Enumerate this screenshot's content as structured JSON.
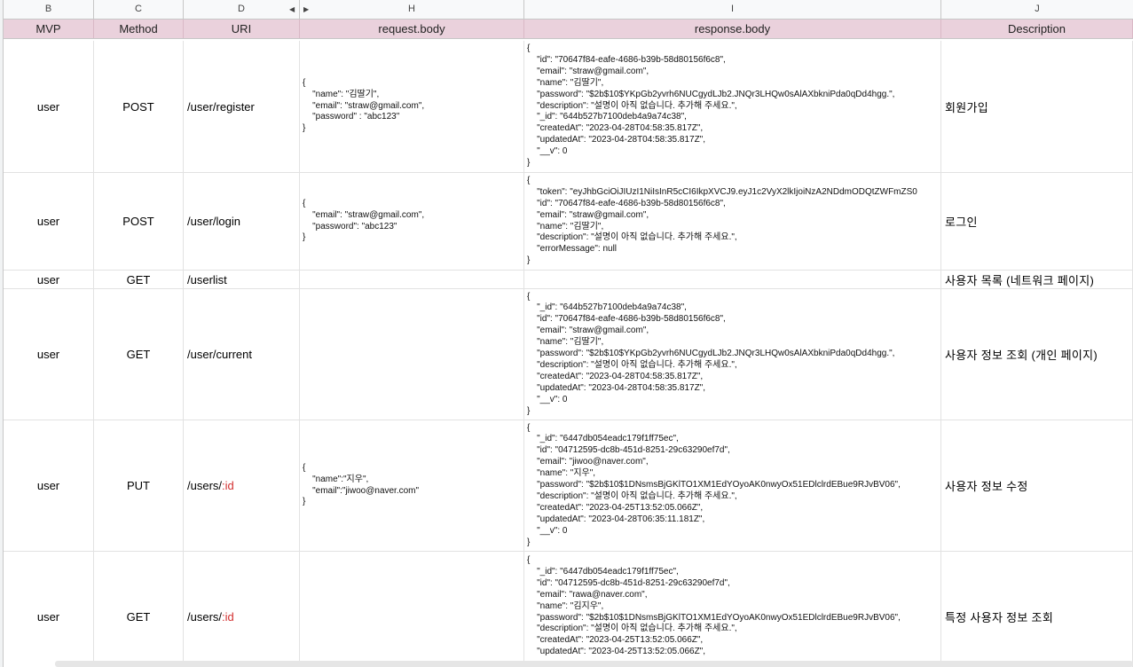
{
  "columns": [
    "B",
    "C",
    "D",
    "H",
    "I",
    "J"
  ],
  "headers": {
    "mvp": "MVP",
    "method": "Method",
    "uri": "URI",
    "request": "request.body",
    "response": "response.body",
    "description": "Description"
  },
  "rows": [
    {
      "mvp": "user",
      "method": "POST",
      "uri": "/user/register",
      "uri_param": "",
      "request": "{\n    \"name\": \"김딸기\",\n    \"email\": \"straw@gmail.com\",\n    \"password\" : \"abc123\"\n}",
      "response": "{\n    \"id\": \"70647f84-eafe-4686-b39b-58d80156f6c8\",\n    \"email\": \"straw@gmail.com\",\n    \"name\": \"김딸기\",\n    \"password\": \"$2b$10$YKpGb2yvrh6NUCgydLJb2.JNQr3LHQw0sAlAXbkniPda0qDd4hgg.\",\n    \"description\": \"설명이 아직 없습니다. 추가해 주세요.\",\n    \"_id\": \"644b527b7100deb4a9a74c38\",\n    \"createdAt\": \"2023-04-28T04:58:35.817Z\",\n    \"updatedAt\": \"2023-04-28T04:58:35.817Z\",\n    \"__v\": 0\n}",
      "description": "회원가입"
    },
    {
      "mvp": "user",
      "method": "POST",
      "uri": "/user/login",
      "uri_param": "",
      "request": "{\n    \"email\": \"straw@gmail.com\",\n    \"password\": \"abc123\"\n}",
      "response": "{\n    \"token\": \"eyJhbGciOiJIUzI1NiIsInR5cCI6IkpXVCJ9.eyJ1c2VyX2lkIjoiNzA2NDdmODQtZWFmZS0\n    \"id\": \"70647f84-eafe-4686-b39b-58d80156f6c8\",\n    \"email\": \"straw@gmail.com\",\n    \"name\": \"김딸기\",\n    \"description\": \"설명이 아직 없습니다. 추가해 주세요.\",\n    \"errorMessage\": null\n}",
      "description": "로그인"
    },
    {
      "mvp": "user",
      "method": "GET",
      "uri": "/userlist",
      "uri_param": "",
      "request": "",
      "response": "",
      "description": "사용자 목록 (네트워크 페이지)"
    },
    {
      "mvp": "user",
      "method": "GET",
      "uri": "/user/current",
      "uri_param": "",
      "request": "",
      "response": "{\n    \"_id\": \"644b527b7100deb4a9a74c38\",\n    \"id\": \"70647f84-eafe-4686-b39b-58d80156f6c8\",\n    \"email\": \"straw@gmail.com\",\n    \"name\": \"김딸기\",\n    \"password\": \"$2b$10$YKpGb2yvrh6NUCgydLJb2.JNQr3LHQw0sAlAXbkniPda0qDd4hgg.\",\n    \"description\": \"설명이 아직 없습니다. 추가해 주세요.\",\n    \"createdAt\": \"2023-04-28T04:58:35.817Z\",\n    \"updatedAt\": \"2023-04-28T04:58:35.817Z\",\n    \"__v\": 0\n}",
      "description": "사용자 정보 조회 (개인 페이지)"
    },
    {
      "mvp": "user",
      "method": "PUT",
      "uri": "/users/",
      "uri_param": ":id",
      "request": "{\n    \"name\":\"지우\",\n    \"email\":\"jiwoo@naver.com\"\n}",
      "response": "{\n    \"_id\": \"6447db054eadc179f1ff75ec\",\n    \"id\": \"04712595-dc8b-451d-8251-29c63290ef7d\",\n    \"email\": \"jiwoo@naver.com\",\n    \"name\": \"지우\",\n    \"password\": \"$2b$10$1DNsmsBjGKlTO1XM1EdYOyoAK0nwyOx51EDlclrdEBue9RJvBV06\",\n    \"description\": \"설명이 아직 없습니다. 추가해 주세요.\",\n    \"createdAt\": \"2023-04-25T13:52:05.066Z\",\n    \"updatedAt\": \"2023-04-28T06:35:11.181Z\",\n    \"__v\": 0\n}",
      "description": "사용자 정보 수정"
    },
    {
      "mvp": "user",
      "method": "GET",
      "uri": "/users/",
      "uri_param": ":id",
      "request": "",
      "response": "{\n    \"_id\": \"6447db054eadc179f1ff75ec\",\n    \"id\": \"04712595-dc8b-451d-8251-29c63290ef7d\",\n    \"email\": \"rawa@naver.com\",\n    \"name\": \"김지우\",\n    \"password\": \"$2b$10$1DNsmsBjGKlTO1XM1EdYOyoAK0nwyOx51EDlclrdEBue9RJvBV06\",\n    \"description\": \"설명이 아직 없습니다. 추가해 주세요.\",\n    \"createdAt\": \"2023-04-25T13:52:05.066Z\",\n    \"updatedAt\": \"2023-04-25T13:52:05.066Z\",",
      "description": "특정 사용자 정보 조회"
    }
  ]
}
